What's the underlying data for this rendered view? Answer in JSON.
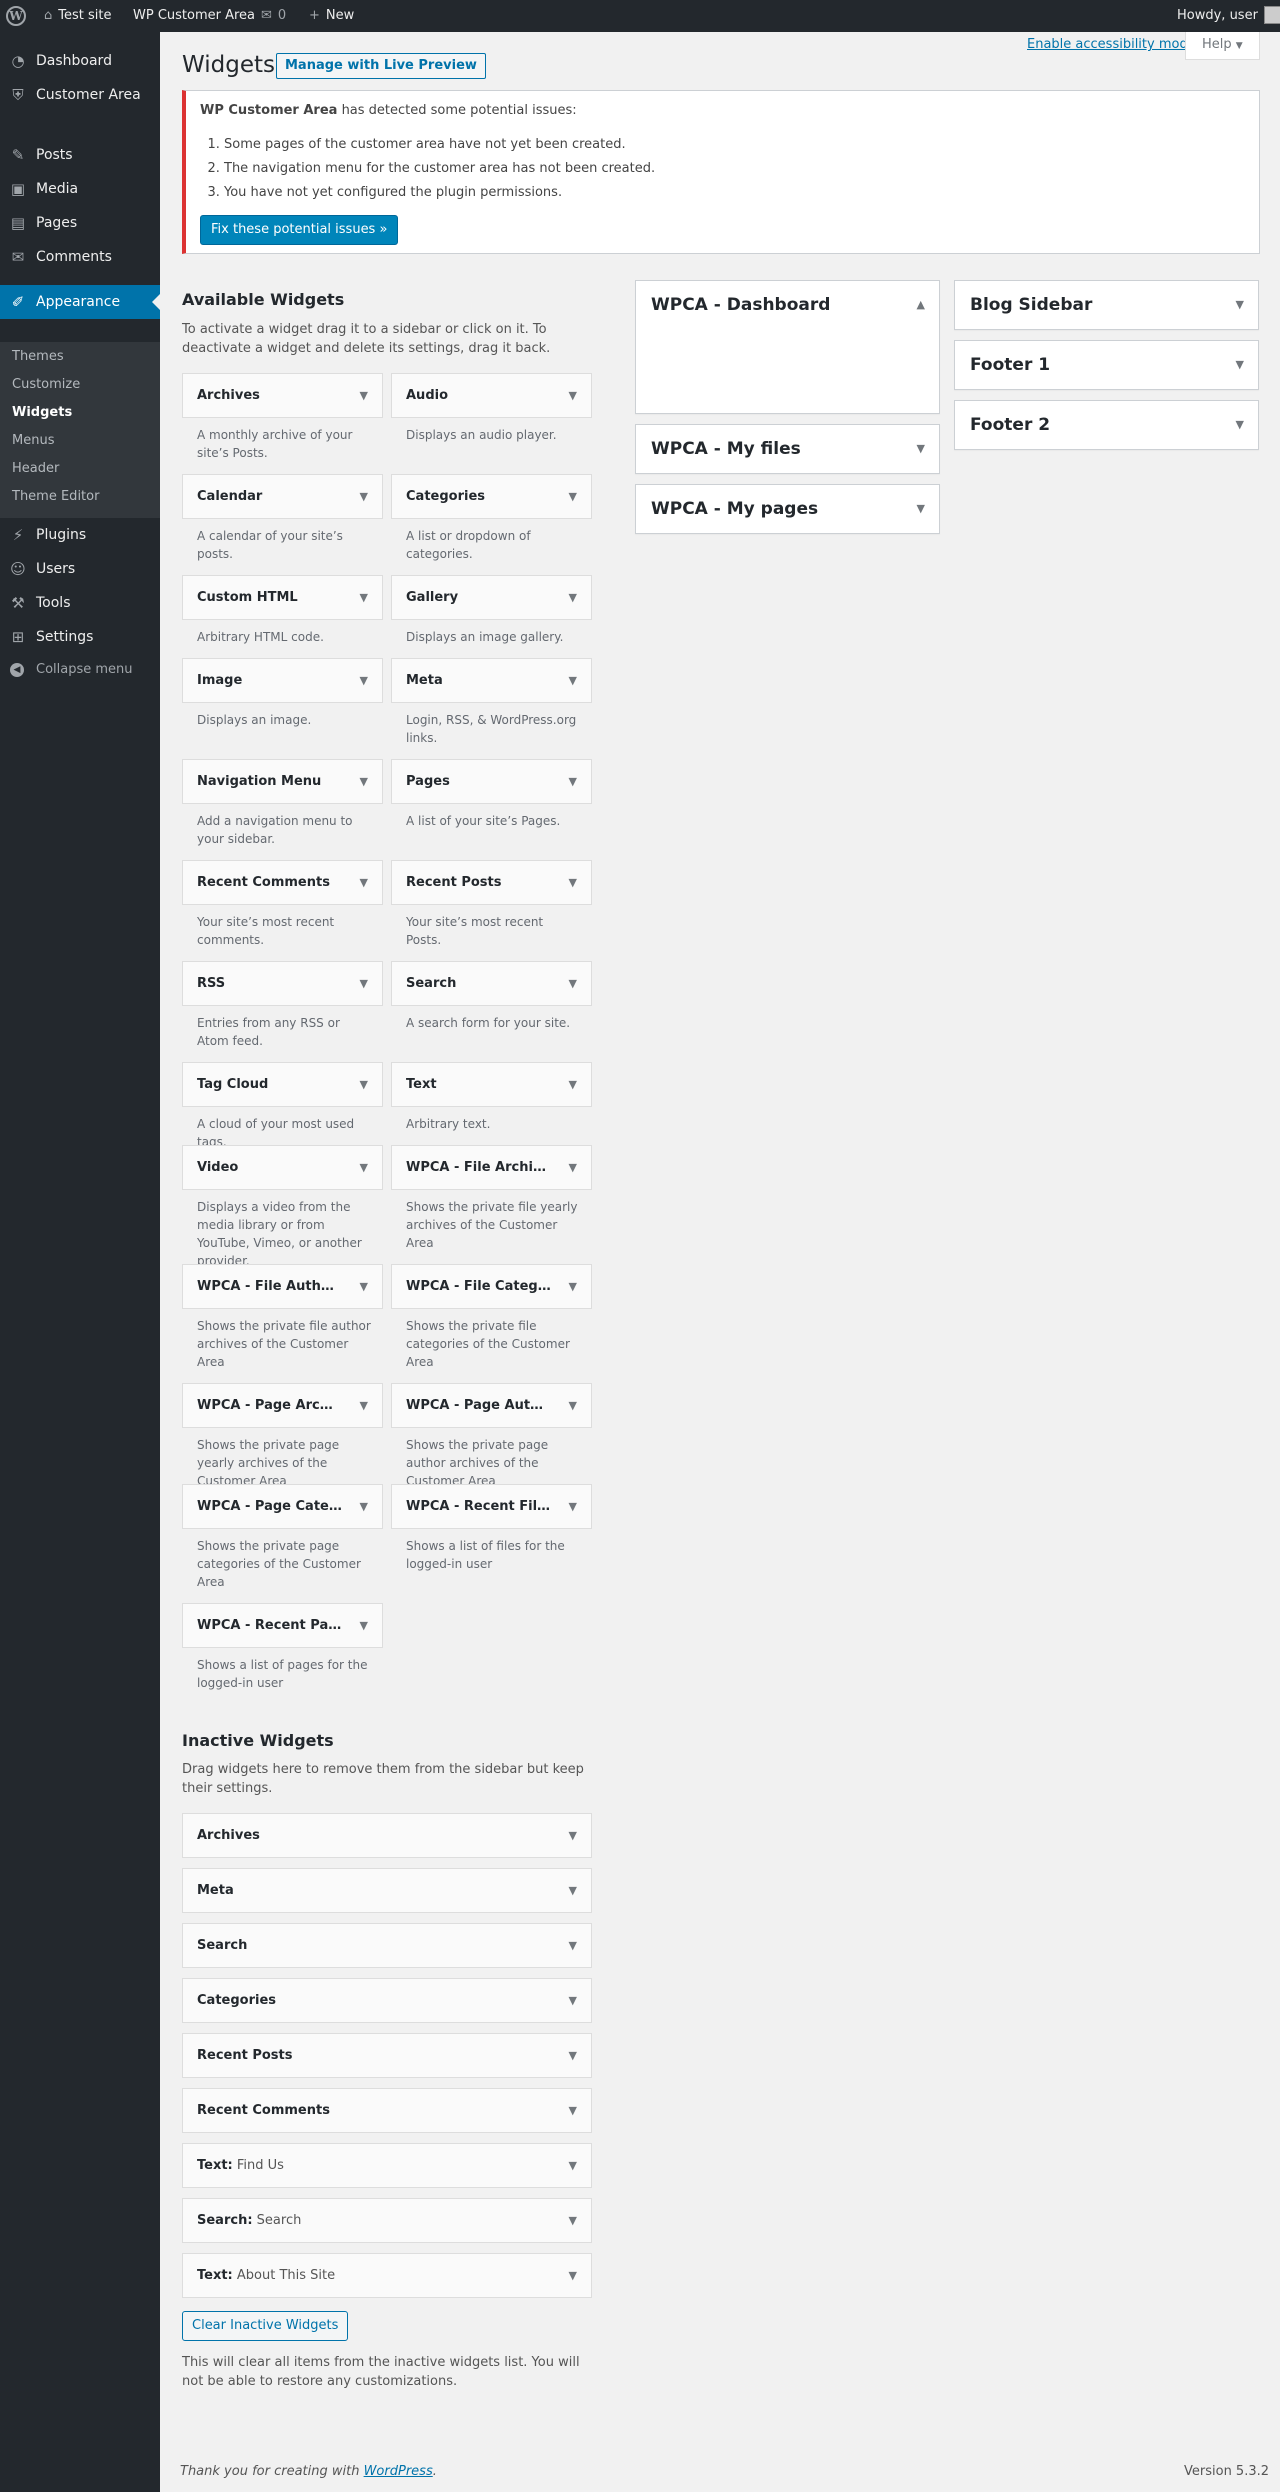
{
  "adminbar": {
    "site_name": "Test site",
    "plugin_name": "WP Customer Area",
    "comments_count": "0",
    "new_label": "New",
    "howdy": "Howdy, user"
  },
  "sidebar": {
    "items": [
      {
        "label": "Dashboard",
        "icon": "dashboard-icon"
      },
      {
        "label": "Customer Area",
        "icon": "customer-area-icon"
      },
      {
        "label": "Posts",
        "icon": "pushpin-icon"
      },
      {
        "label": "Media",
        "icon": "media-icon"
      },
      {
        "label": "Pages",
        "icon": "pages-icon"
      },
      {
        "label": "Comments",
        "icon": "comments-icon"
      },
      {
        "label": "Appearance",
        "icon": "paintbrush-icon"
      },
      {
        "label": "Plugins",
        "icon": "plugin-icon"
      },
      {
        "label": "Users",
        "icon": "users-icon"
      },
      {
        "label": "Tools",
        "icon": "wrench-icon"
      },
      {
        "label": "Settings",
        "icon": "settings-icon"
      }
    ],
    "submenu": [
      "Themes",
      "Customize",
      "Widgets",
      "Menus",
      "Header",
      "Theme Editor"
    ],
    "collapse_label": "Collapse menu"
  },
  "screen_meta": {
    "accessibility_link": "Enable accessibility mode",
    "help_label": "Help"
  },
  "page": {
    "title": "Widgets",
    "live_preview_button": "Manage with Live Preview"
  },
  "notice": {
    "plugin": "WP Customer Area",
    "message": " has detected some potential issues:",
    "issues": [
      "Some pages of the customer area have not yet been created.",
      "The navigation menu for the customer area has not been created.",
      "You have not yet configured the plugin permissions."
    ],
    "fix_button": "Fix these potential issues »"
  },
  "available": {
    "title": "Available Widgets",
    "description": "To activate a widget drag it to a sidebar or click on it. To deactivate a widget and delete its settings, drag it back.",
    "widgets": [
      {
        "name": "Archives",
        "desc": "A monthly archive of your site’s Posts."
      },
      {
        "name": "Audio",
        "desc": "Displays an audio player."
      },
      {
        "name": "Calendar",
        "desc": "A calendar of your site’s posts."
      },
      {
        "name": "Categories",
        "desc": "A list or dropdown of categories."
      },
      {
        "name": "Custom HTML",
        "desc": "Arbitrary HTML code."
      },
      {
        "name": "Gallery",
        "desc": "Displays an image gallery."
      },
      {
        "name": "Image",
        "desc": "Displays an image."
      },
      {
        "name": "Meta",
        "desc": "Login, RSS, & WordPress.org links."
      },
      {
        "name": "Navigation Menu",
        "desc": "Add a navigation menu to your sidebar."
      },
      {
        "name": "Pages",
        "desc": "A list of your site’s Pages."
      },
      {
        "name": "Recent Comments",
        "desc": "Your site’s most recent comments."
      },
      {
        "name": "Recent Posts",
        "desc": "Your site’s most recent Posts."
      },
      {
        "name": "RSS",
        "desc": "Entries from any RSS or Atom feed."
      },
      {
        "name": "Search",
        "desc": "A search form for your site."
      },
      {
        "name": "Tag Cloud",
        "desc": "A cloud of your most used tags."
      },
      {
        "name": "Text",
        "desc": "Arbitrary text."
      },
      {
        "name": "Video",
        "desc": "Displays a video from the media library or from YouTube, Vimeo, or another provider."
      },
      {
        "name": "WPCA - File Archi…",
        "desc": "Shows the private file yearly archives of the Customer Area"
      },
      {
        "name": "WPCA - File Auth…",
        "desc": "Shows the private file author archives of the Customer Area"
      },
      {
        "name": "WPCA - File Categ…",
        "desc": "Shows the private file categories of the Customer Area"
      },
      {
        "name": "WPCA - Page Arc…",
        "desc": "Shows the private page yearly archives of the Customer Area"
      },
      {
        "name": "WPCA - Page Aut…",
        "desc": "Shows the private page author archives of the Customer Area"
      },
      {
        "name": "WPCA - Page Cate…",
        "desc": "Shows the private page categories of the Customer Area"
      },
      {
        "name": "WPCA - Recent Fil…",
        "desc": "Shows a list of files for the logged-in user"
      },
      {
        "name": "WPCA - Recent Pa…",
        "desc": "Shows a list of pages for the logged-in user"
      }
    ]
  },
  "inactive": {
    "title": "Inactive Widgets",
    "description": "Drag widgets here to remove them from the sidebar but keep their settings.",
    "widgets": [
      {
        "name": "Archives",
        "sub": ""
      },
      {
        "name": "Meta",
        "sub": ""
      },
      {
        "name": "Search",
        "sub": ""
      },
      {
        "name": "Categories",
        "sub": ""
      },
      {
        "name": "Recent Posts",
        "sub": ""
      },
      {
        "name": "Recent Comments",
        "sub": ""
      },
      {
        "name": "Text:",
        "sub": " Find Us"
      },
      {
        "name": "Search:",
        "sub": " Search"
      },
      {
        "name": "Text:",
        "sub": " About This Site"
      }
    ],
    "clear_button": "Clear Inactive Widgets",
    "clear_description": "This will clear all items from the inactive widgets list. You will not be able to restore any customizations."
  },
  "sidebars": {
    "column1": [
      "WPCA - Dashboard",
      "WPCA - My files",
      "WPCA - My pages"
    ],
    "column2": [
      "Blog Sidebar",
      "Footer 1",
      "Footer 2"
    ]
  },
  "footer": {
    "thanks_prefix": "Thank you for creating with ",
    "thanks_link": "WordPress",
    "thanks_suffix": ".",
    "version": "Version 5.3.2"
  },
  "colors": {
    "accent": "#0073aa",
    "admin_bar": "#23282d",
    "notice_error": "#dc3232",
    "primary_button": "#0085ba"
  }
}
